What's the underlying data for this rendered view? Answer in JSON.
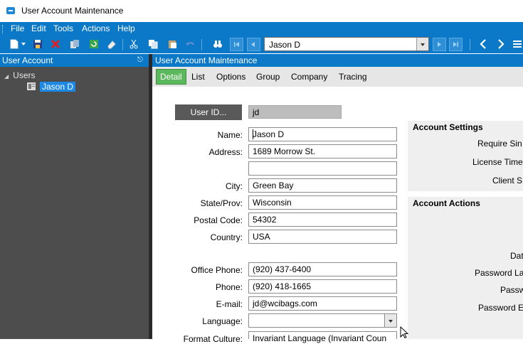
{
  "window": {
    "title": "User Account Maintenance"
  },
  "menu": [
    "File",
    "Edit",
    "Tools",
    "Actions",
    "Help"
  ],
  "toolbar": {
    "record_combo_value": "Jason D"
  },
  "left_panel": {
    "title": "User Account",
    "tree": {
      "root": "Users",
      "selected": "Jason D"
    }
  },
  "right_panel": {
    "title": "User Account Maintenance"
  },
  "tabs": [
    "Detail",
    "List",
    "Options",
    "Group",
    "Company",
    "Tracing"
  ],
  "form": {
    "user_id_button": "User ID...",
    "user_id": "jd",
    "fields": [
      {
        "label": "Name:",
        "value": "Jason D"
      },
      {
        "label": "Address:",
        "value": "1689 Morrow St."
      },
      {
        "label": "",
        "value": ""
      },
      {
        "label": "City:",
        "value": "Green Bay"
      },
      {
        "label": "State/Prov:",
        "value": "Wisconsin"
      },
      {
        "label": "Postal Code:",
        "value": "54302"
      },
      {
        "label": "Country:",
        "value": "USA"
      },
      {
        "label": "Office Phone:",
        "value": "(920) 437-6400"
      },
      {
        "label": "Phone:",
        "value": "(920) 418-1665"
      },
      {
        "label": "E-mail:",
        "value": "jd@wcibags.com"
      },
      {
        "label": "Language:",
        "value": ""
      },
      {
        "label": "Format Culture:",
        "value": "Invariant Language (Invariant Coun"
      }
    ]
  },
  "account_settings": {
    "title": "Account Settings",
    "labels": [
      "Require Sin",
      "License Time",
      "Client S"
    ]
  },
  "account_actions": {
    "title": "Account Actions",
    "labels": [
      "Dat",
      "Password La",
      "Passw",
      "Password E"
    ]
  },
  "colors": {
    "accent": "#0b78c8",
    "active_tab": "#5cb85c",
    "left_panel_bg": "#4d4d4d"
  }
}
